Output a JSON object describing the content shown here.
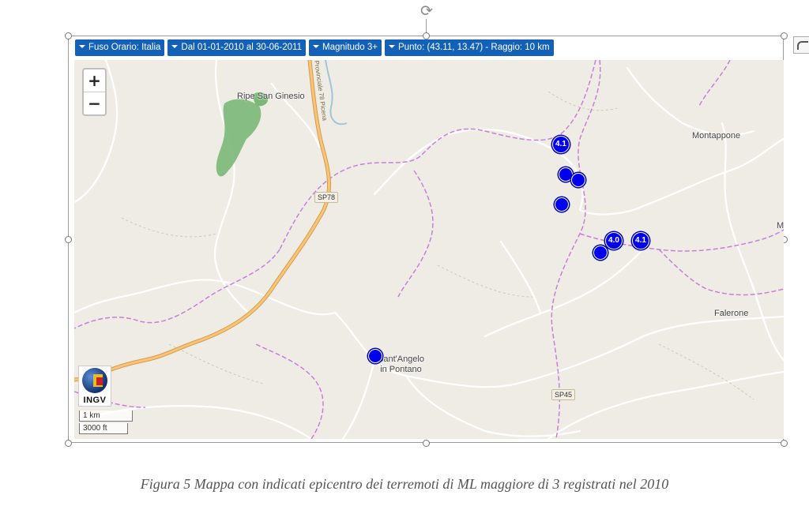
{
  "filters": [
    {
      "label": "Fuso Orario: Italia"
    },
    {
      "label": "Dal 01-01-2010 al 30-06-2011"
    },
    {
      "label": "Magnitudo 3+"
    },
    {
      "label": "Punto: (43.11, 13.47) - Raggio: 10 km"
    }
  ],
  "zoom": {
    "in": "+",
    "out": "−"
  },
  "places": {
    "ripe": "Ripe San Ginesio",
    "montappone": "Montappone",
    "falerone": "Falerone",
    "santangelo_1": "Sant'Angelo",
    "santangelo_2": "in Pontano",
    "edge_m": "M"
  },
  "roads": {
    "sp78": "SP78",
    "sp45": "SP45",
    "provinciale": "Provinciale 78 Picena"
  },
  "earthquakes": [
    {
      "label": "4.1"
    },
    {
      "label": ""
    },
    {
      "label": ""
    },
    {
      "label": ""
    },
    {
      "label": "4.0"
    },
    {
      "label": "4.1"
    },
    {
      "label": ""
    },
    {
      "label": ""
    }
  ],
  "logo": {
    "text": "INGV"
  },
  "scale": {
    "km": "1 km",
    "ft": "3000 ft"
  },
  "caption": "Figura 5 Mappa con indicati epicentro dei terremoti di ML maggiore di 3 registrati nel 2010",
  "colors": {
    "filter_button": "#1360b8",
    "marker": "#0000ee",
    "boundary": "#c77fd6",
    "main_road": "#f0b45c",
    "map_bg": "#efece6"
  }
}
